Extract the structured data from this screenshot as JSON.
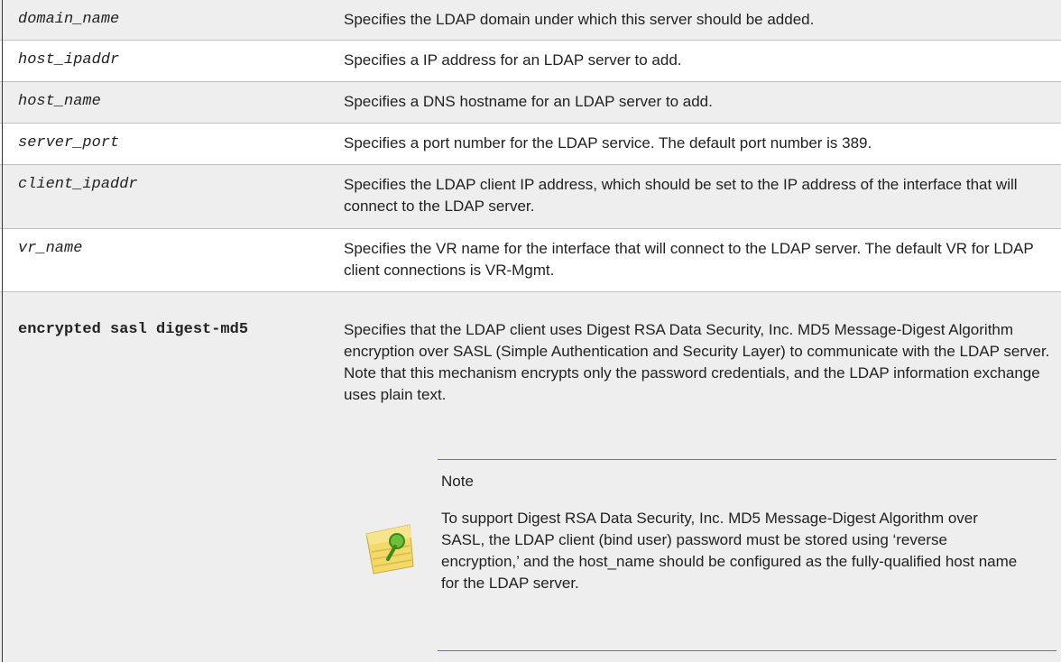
{
  "rows": [
    {
      "param": "domain_name",
      "desc": "Specifies the LDAP domain under which this server should be added."
    },
    {
      "param": "host_ipaddr",
      "desc": "Specifies a IP address for an LDAP server to add."
    },
    {
      "param": "host_name",
      "desc": "Specifies a DNS hostname for an LDAP server to add."
    },
    {
      "param": "server_port",
      "desc": "Specifies a port number for the LDAP service. The default port number is 389."
    },
    {
      "param": "client_ipaddr",
      "desc": "Specifies the LDAP client IP address, which should be set to the IP address of the interface that will connect to the LDAP server."
    },
    {
      "param": "vr_name",
      "desc": "Specifies the VR name for the interface that will connect to the LDAP server. The default VR for LDAP client connections is VR-Mgmt."
    },
    {
      "param": "encrypted sasl digest-md5",
      "desc": "Specifies that the LDAP client uses Digest RSA Data Security, Inc. MD5 Message-Digest Algorithm encryption over SASL (Simple Authentication and Security Layer) to communicate with the LDAP server. Note that this mechanism encrypts only the password credentials, and the LDAP information exchange uses plain text."
    }
  ],
  "note": {
    "title": "Note",
    "text": "To support Digest RSA Data Security, Inc. MD5 Message-Digest Algorithm over SASL, the LDAP client (bind user) password must be stored using ‘reverse encryption,’ and the host_name should be configured as the fully-qualified host name for the LDAP server.",
    "icon": "sticky-note-pin-icon"
  }
}
